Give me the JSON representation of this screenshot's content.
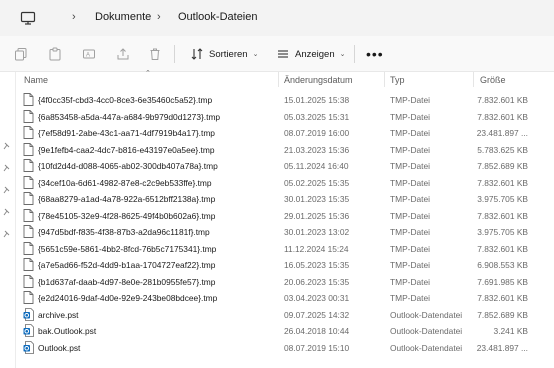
{
  "breadcrumb": [
    "Dokumente",
    "Outlook-Dateien"
  ],
  "toolbar": {
    "sort_label": "Sortieren",
    "view_label": "Anzeigen",
    "more_label": "•••"
  },
  "columns": {
    "name": "Name",
    "date": "Änderungsdatum",
    "type": "Typ",
    "size": "Größe"
  },
  "files": [
    {
      "name": "{4f0cc35f-cbd3-4cc0-8ce3-6e35460c5a52}.tmp",
      "date": "15.01.2025 15:38",
      "type": "TMP-Datei",
      "size": "7.832.601 KB",
      "icon": "file-icon"
    },
    {
      "name": "{6a853458-a5da-447a-a684-9b979d0d1273}.tmp",
      "date": "05.03.2025 15:31",
      "type": "TMP-Datei",
      "size": "7.832.601 KB",
      "icon": "file-icon"
    },
    {
      "name": "{7ef58d91-2abe-43c1-aa71-4df7919b4a17}.tmp",
      "date": "08.07.2019 16:00",
      "type": "TMP-Datei",
      "size": "23.481.897 ...",
      "icon": "file-icon"
    },
    {
      "name": "{9e1fefb4-caa2-4dc7-b816-e43197e0a5ee}.tmp",
      "date": "21.03.2023 15:36",
      "type": "TMP-Datei",
      "size": "5.783.625 KB",
      "icon": "file-icon"
    },
    {
      "name": "{10fd2d4d-d088-4065-ab02-300db407a78a}.tmp",
      "date": "05.11.2024 16:40",
      "type": "TMP-Datei",
      "size": "7.852.689 KB",
      "icon": "file-icon"
    },
    {
      "name": "{34cef10a-6d61-4982-87e8-c2c9eb533ffe}.tmp",
      "date": "05.02.2025 15:35",
      "type": "TMP-Datei",
      "size": "7.832.601 KB",
      "icon": "file-icon"
    },
    {
      "name": "{68aa8279-a1ad-4a78-922a-6512bff2138a}.tmp",
      "date": "30.01.2023 15:35",
      "type": "TMP-Datei",
      "size": "3.975.705 KB",
      "icon": "file-icon"
    },
    {
      "name": "{78e45105-32e9-4f28-8625-49f4b0b602a6}.tmp",
      "date": "29.01.2025 15:36",
      "type": "TMP-Datei",
      "size": "7.832.601 KB",
      "icon": "file-icon"
    },
    {
      "name": "{947d5bdf-f835-4f38-87b3-a2da96c1181f}.tmp",
      "date": "30.01.2023 13:02",
      "type": "TMP-Datei",
      "size": "3.975.705 KB",
      "icon": "file-icon"
    },
    {
      "name": "{5651c59e-5861-4bb2-8fcd-76b5c7175341}.tmp",
      "date": "11.12.2024 15:24",
      "type": "TMP-Datei",
      "size": "7.832.601 KB",
      "icon": "file-icon"
    },
    {
      "name": "{a7e5ad66-f52d-4dd9-b1aa-1704727eaf22}.tmp",
      "date": "16.05.2023 15:35",
      "type": "TMP-Datei",
      "size": "6.908.553 KB",
      "icon": "file-icon"
    },
    {
      "name": "{b1d637af-daab-4d97-8e0e-281b0955fe57}.tmp",
      "date": "20.06.2023 15:35",
      "type": "TMP-Datei",
      "size": "7.691.985 KB",
      "icon": "file-icon"
    },
    {
      "name": "{e2d24016-9daf-4d0e-92e9-243be08bdcee}.tmp",
      "date": "03.04.2023 00:31",
      "type": "TMP-Datei",
      "size": "7.832.601 KB",
      "icon": "file-icon"
    },
    {
      "name": "archive.pst",
      "date": "09.07.2025 14:32",
      "type": "Outlook-Datendatei",
      "size": "7.852.689 KB",
      "icon": "outlook-file-icon"
    },
    {
      "name": "bak.Outlook.pst",
      "date": "26.04.2018 10:44",
      "type": "Outlook-Datendatei",
      "size": "3.241 KB",
      "icon": "outlook-file-icon"
    },
    {
      "name": "Outlook.pst",
      "date": "08.07.2019 15:10",
      "type": "Outlook-Datendatei",
      "size": "23.481.897 ...",
      "icon": "outlook-file-icon"
    }
  ],
  "colors": {
    "outlook_blue": "#0f6cbd",
    "address_bg": "#f3f3f3",
    "toolbar_bg": "#f9f9f9"
  }
}
